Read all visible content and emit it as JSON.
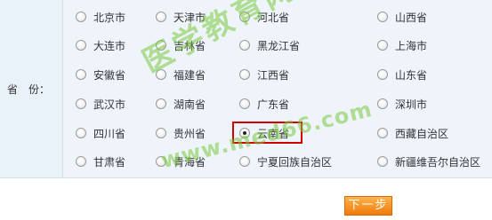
{
  "field_label": "省　份：",
  "provinces": [
    "北京市",
    "天津市",
    "河北省",
    "山西省",
    "大连市",
    "吉林省",
    "黑龙江省",
    "上海市",
    "安徽省",
    "福建省",
    "江西省",
    "山东省",
    "武汉市",
    "湖南省",
    "广东省",
    "深圳市",
    "四川省",
    "贵州省",
    "云南省",
    "西藏自治区",
    "甘肃省",
    "青海省",
    "宁夏回族自治区",
    "新疆维吾尔自治区"
  ],
  "selected": "云南省",
  "watermark": {
    "text_cn": "医学教育网",
    "text_url": "www.med66.com",
    "color": "#78c83c"
  },
  "next_button_label": "下一步",
  "colors": {
    "panel_bg": "#eef4fa",
    "highlight_border": "#d40000",
    "button_orange": "#f07b0c"
  }
}
